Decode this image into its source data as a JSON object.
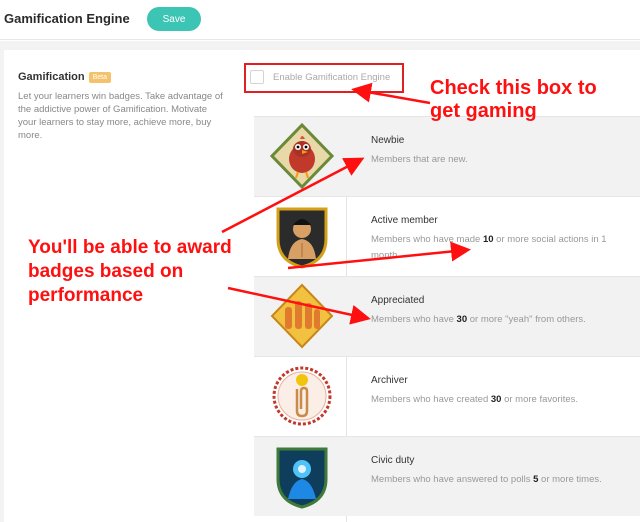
{
  "header": {
    "title": "Gamification Engine",
    "save_label": "Save"
  },
  "section": {
    "title": "Gamification",
    "beta_label": "Beta",
    "description": "Let your learners win badges. Take advantage of the addictive power of Gamification. Motivate your learners to stay more, achieve more, buy more."
  },
  "enable": {
    "label": "Enable Gamification Engine",
    "checked": false
  },
  "badges": [
    {
      "name": "Newbie",
      "desc_pre": "Members that are new.",
      "desc_num": "",
      "desc_post": "",
      "icon": "chicken-badge-icon"
    },
    {
      "name": "Active member",
      "desc_pre": "Members who have made ",
      "desc_num": "10",
      "desc_post": " or more social actions in 1 month.",
      "icon": "fighter-badge-icon"
    },
    {
      "name": "Appreciated",
      "desc_pre": "Members who have ",
      "desc_num": "30",
      "desc_post": " or more \"yeah\" from others.",
      "icon": "raised-hands-badge-icon"
    },
    {
      "name": "Archiver",
      "desc_pre": "Members who have created ",
      "desc_num": "30",
      "desc_post": " or more favorites.",
      "icon": "paperclip-badge-icon"
    },
    {
      "name": "Civic duty",
      "desc_pre": "Members who have answered to polls ",
      "desc_num": "5",
      "desc_post": " or more times.",
      "icon": "civic-badge-icon"
    }
  ],
  "annotations": {
    "checkbox_hint": [
      "Check this box to",
      "get gaming"
    ],
    "badges_hint": [
      "You'll be able to award",
      "badges based on",
      "performance"
    ],
    "color": "#ff1010"
  }
}
